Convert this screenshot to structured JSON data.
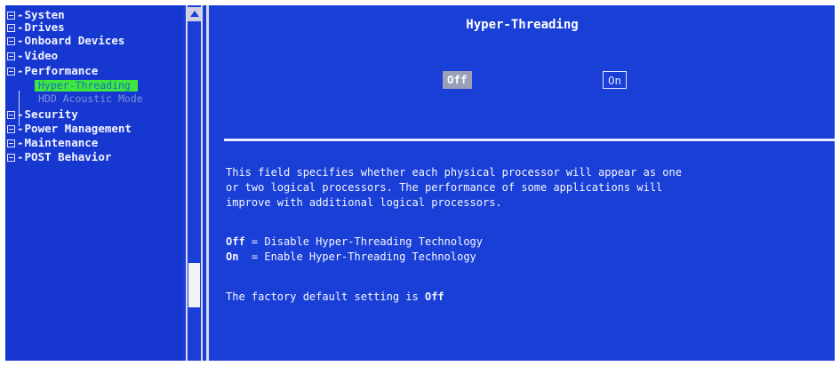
{
  "tree": {
    "items": [
      {
        "label": "Systen"
      },
      {
        "label": "Drives"
      },
      {
        "label": "Onboard Devices"
      },
      {
        "label": "Video"
      },
      {
        "label": "Performance"
      },
      {
        "label": "Security"
      },
      {
        "label": "Power Management"
      },
      {
        "label": "Maintenance"
      },
      {
        "label": "POST Behavior"
      }
    ],
    "sub_items": [
      {
        "label": "Hyper-Threading"
      },
      {
        "label": "HDD Acoustic Mode"
      }
    ]
  },
  "content": {
    "title": "Hyper-Threading",
    "options": {
      "off": "Off",
      "on": "On"
    },
    "description": [
      "This field specifies whether each physical processor will appear as one",
      "or two logical processors.  The performance of some applications will",
      "improve with additional logical processors."
    ],
    "legend": {
      "off_key": "Off",
      "off_text": " = Disable Hyper-Threading Technology",
      "on_key": "On",
      "on_text": "  = Enable Hyper-Threading Technology"
    },
    "default_prefix": "The factory default setting is ",
    "default_value": "Off"
  },
  "colors": {
    "background": "#1a3fd6",
    "selected_highlight": "#3ee63e",
    "selected_option": "#9aa0b8",
    "text": "#ffffff"
  }
}
